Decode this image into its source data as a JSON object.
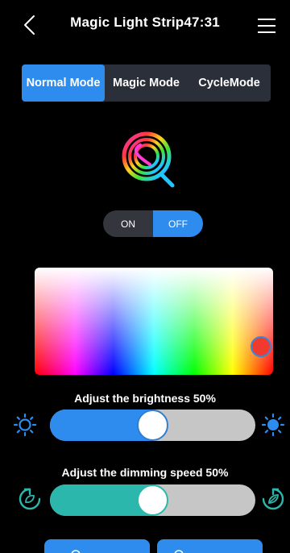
{
  "header": {
    "title": "Magic Light Strip",
    "time": "47:31"
  },
  "icons": {
    "back": "chevron-left-icon",
    "menu": "hamburger-menu-icon",
    "logo": "rainbow-q-logo",
    "brightness_low": "sun-outline-icon",
    "brightness_high": "sun-filled-icon",
    "speed_slow": "leaf-slow-icon",
    "speed_fast": "leaf-fast-icon"
  },
  "tabs": [
    {
      "label": "Normal Mode",
      "active": true
    },
    {
      "label": "Magic Mode",
      "active": false
    },
    {
      "label": "CycleMode",
      "active": false
    }
  ],
  "power": {
    "on_label": "ON",
    "off_label": "OFF",
    "selected": "OFF"
  },
  "brightness": {
    "label": "Adjust the brightness 50%",
    "value": 0.5
  },
  "dimming_speed": {
    "label": "Adjust the dimming speed 50%",
    "value": 0.5
  },
  "colors": {
    "accent": "#2f8cef",
    "tab_bg": "#2a2f3a",
    "speed_accent": "#2cb7ad",
    "selected_color": "#f03a2e",
    "track": "#c6c6c6"
  }
}
